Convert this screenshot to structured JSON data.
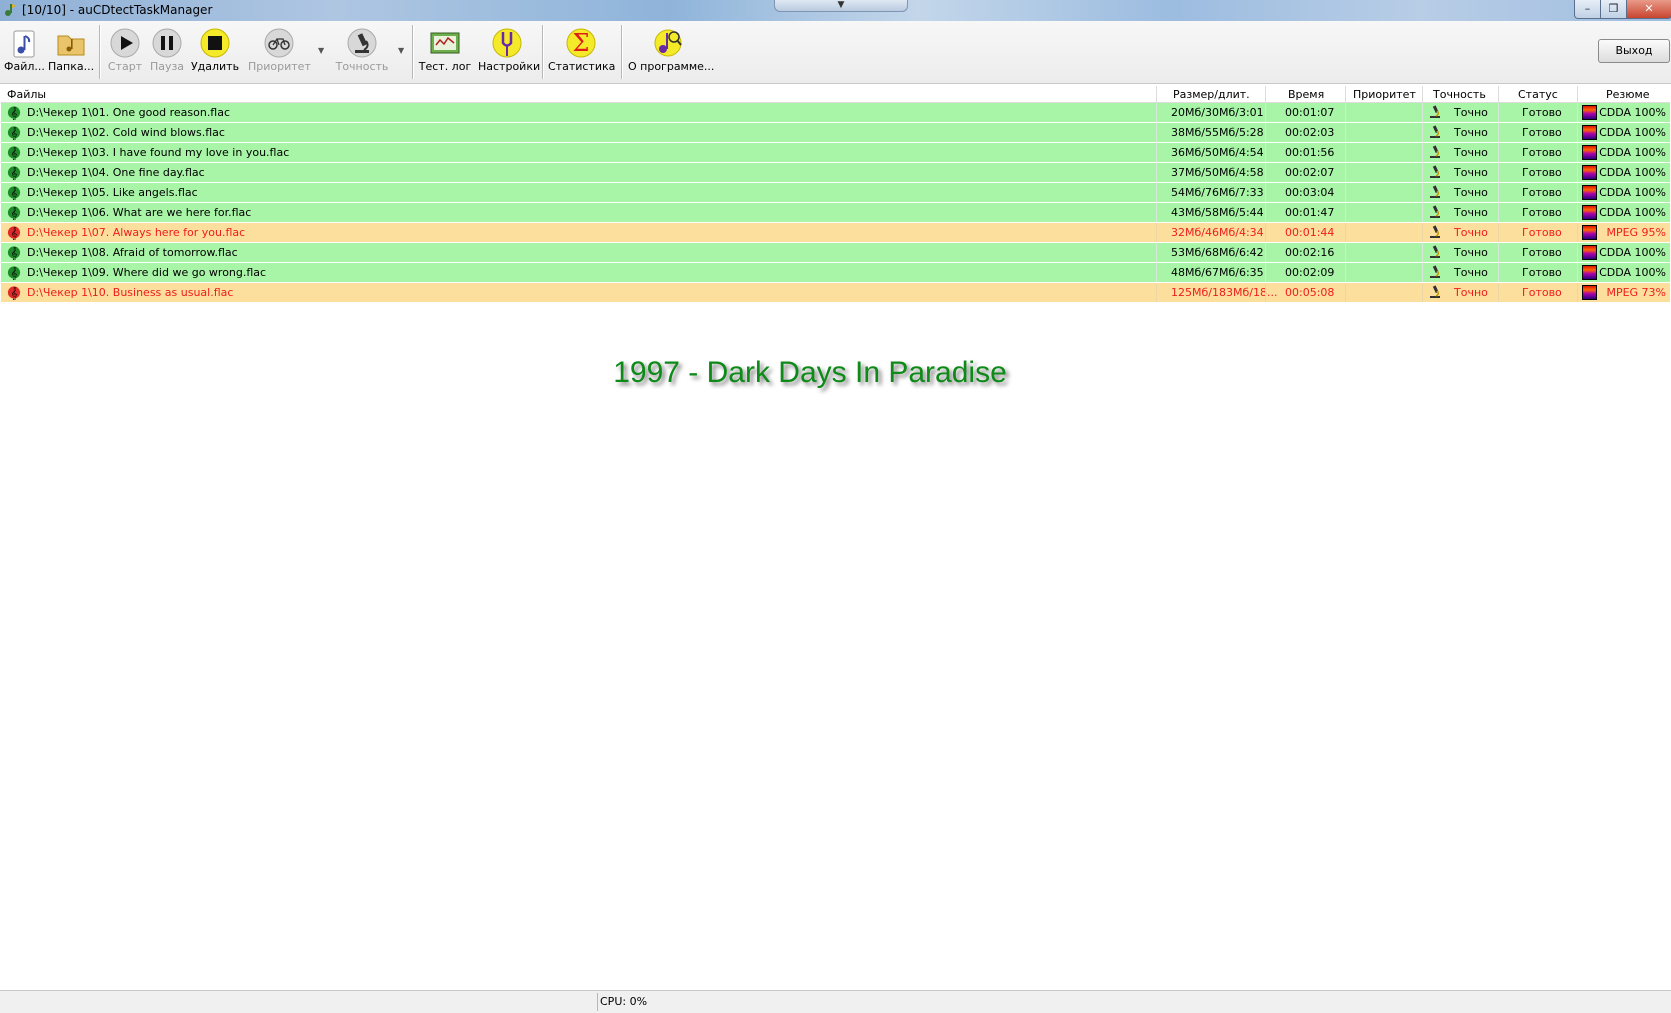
{
  "window": {
    "title": "[10/10] - auCDtectTaskManager",
    "minimize": "–",
    "maximize": "❐",
    "close": "✕",
    "tab_toggle": "▼"
  },
  "toolbar": {
    "files": "Файл...",
    "folder": "Папка...",
    "start": "Старт",
    "pause": "Пауза",
    "delete": "Удалить",
    "priority": "Приоритет",
    "accuracy": "Точность",
    "test_log": "Тест. лог",
    "settings": "Настройки",
    "statistics": "Статистика",
    "about": "О программе...",
    "exit": "Выход",
    "dropdown_arrow": "▼"
  },
  "table": {
    "headers": {
      "files": "Файлы",
      "size": "Размер/длит.",
      "time": "Время",
      "priority": "Приоритет",
      "accuracy": "Точность",
      "status": "Статус",
      "summary": "Резюме"
    },
    "rows": [
      {
        "file": "D:\\Чекер 1\\01. One good reason.flac",
        "size": "20Мб/30Мб/3:01",
        "time": "00:01:07",
        "accuracy": "Точно",
        "status": "Готово",
        "summary": "CDDA 100%",
        "state": "ok"
      },
      {
        "file": "D:\\Чекер 1\\02. Cold wind blows.flac",
        "size": "38Мб/55Мб/5:28",
        "time": "00:02:03",
        "accuracy": "Точно",
        "status": "Готово",
        "summary": "CDDA 100%",
        "state": "ok"
      },
      {
        "file": "D:\\Чекер 1\\03. I have found my love in you.flac",
        "size": "36Мб/50Мб/4:54",
        "time": "00:01:56",
        "accuracy": "Точно",
        "status": "Готово",
        "summary": "CDDA 100%",
        "state": "ok"
      },
      {
        "file": "D:\\Чекер 1\\04. One fine day.flac",
        "size": "37Мб/50Мб/4:58",
        "time": "00:02:07",
        "accuracy": "Точно",
        "status": "Готово",
        "summary": "CDDA 100%",
        "state": "ok"
      },
      {
        "file": "D:\\Чекер 1\\05. Like angels.flac",
        "size": "54Мб/76Мб/7:33",
        "time": "00:03:04",
        "accuracy": "Точно",
        "status": "Готово",
        "summary": "CDDA 100%",
        "state": "ok"
      },
      {
        "file": "D:\\Чекер 1\\06. What are we here for.flac",
        "size": "43Мб/58Мб/5:44",
        "time": "00:01:47",
        "accuracy": "Точно",
        "status": "Готово",
        "summary": "CDDA 100%",
        "state": "ok"
      },
      {
        "file": "D:\\Чекер 1\\07. Always here for you.flac",
        "size": "32Мб/46Мб/4:34",
        "time": "00:01:44",
        "accuracy": "Точно",
        "status": "Готово",
        "summary": "MPEG 95%",
        "state": "bad"
      },
      {
        "file": "D:\\Чекер 1\\08. Afraid of tomorrow.flac",
        "size": "53Мб/68Мб/6:42",
        "time": "00:02:16",
        "accuracy": "Точно",
        "status": "Готово",
        "summary": "CDDA 100%",
        "state": "ok"
      },
      {
        "file": "D:\\Чекер 1\\09. Where did we go wrong.flac",
        "size": "48Мб/67Мб/6:35",
        "time": "00:02:09",
        "accuracy": "Точно",
        "status": "Готово",
        "summary": "CDDA 100%",
        "state": "ok"
      },
      {
        "file": "D:\\Чекер 1\\10. Business as usual.flac",
        "size": "125Мб/183Мб/18...",
        "time": "00:05:08",
        "accuracy": "Точно",
        "status": "Готово",
        "summary": "MPEG 73%",
        "state": "bad"
      }
    ]
  },
  "album_label": "1997 - Dark Days In Paradise",
  "statusbar": {
    "cpu": "CPU: 0%"
  },
  "colors": {
    "row_ok": "#a8f5a8",
    "row_bad": "#fddf9d",
    "text_bad": "#ee1c1c",
    "album_text": "#0d8a18"
  }
}
